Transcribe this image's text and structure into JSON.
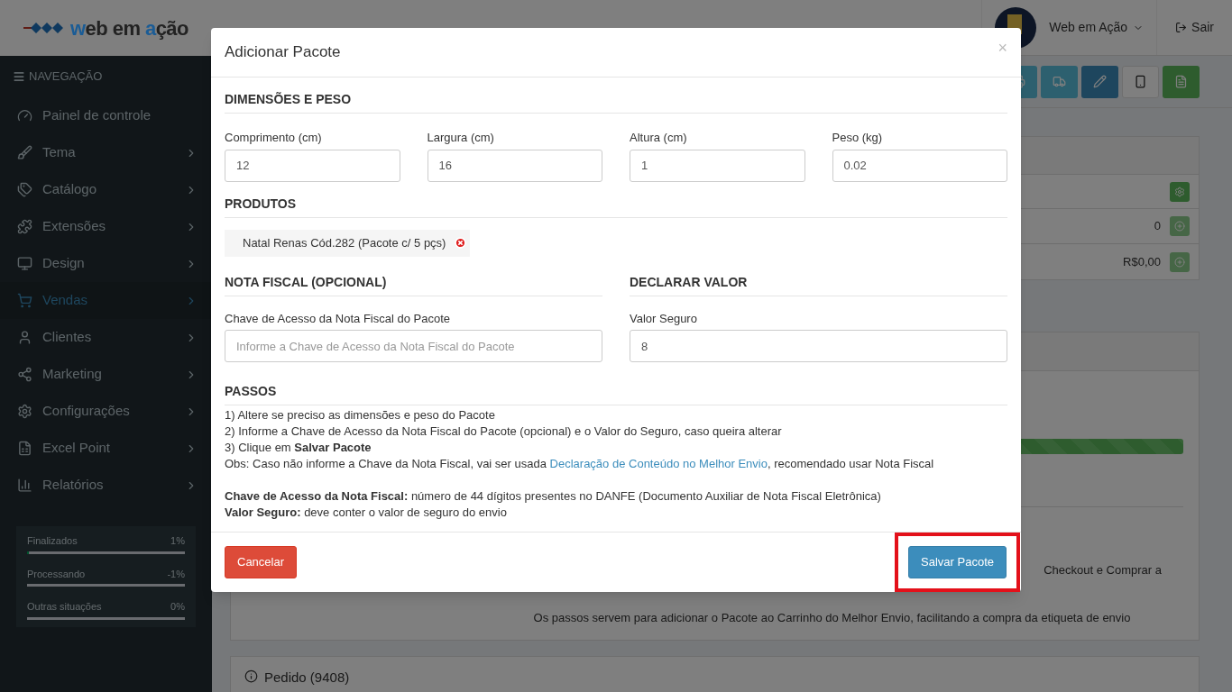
{
  "header": {
    "logo": [
      {
        "text": "w",
        "color": "#1a5c96"
      },
      {
        "text": "eb em ",
        "color": "#222222"
      },
      {
        "text": "a",
        "color": "#1a5c96"
      },
      {
        "text": "ção",
        "color": "#222222"
      }
    ],
    "user": "Web em Ação",
    "logout": "Sair"
  },
  "sidebar": {
    "heading": "NAVEGAÇÃO",
    "items": [
      {
        "label": "Painel de controle",
        "selected": false,
        "expandable": false
      },
      {
        "label": "Tema",
        "selected": false,
        "expandable": true
      },
      {
        "label": "Catálogo",
        "selected": false,
        "expandable": true
      },
      {
        "label": "Extensões",
        "selected": false,
        "expandable": true
      },
      {
        "label": "Design",
        "selected": false,
        "expandable": true
      },
      {
        "label": "Vendas",
        "selected": true,
        "expandable": true
      },
      {
        "label": "Clientes",
        "selected": false,
        "expandable": true
      },
      {
        "label": "Marketing",
        "selected": false,
        "expandable": true
      },
      {
        "label": "Configurações",
        "selected": false,
        "expandable": true
      },
      {
        "label": "Excel Point",
        "selected": false,
        "expandable": true
      },
      {
        "label": "Relatórios",
        "selected": false,
        "expandable": true
      }
    ],
    "stats": [
      {
        "label": "Finalizados",
        "value": "1%",
        "level": 0.01
      },
      {
        "label": "Processando",
        "value": "-1%"
      },
      {
        "label": "Outras situações",
        "value": "0%"
      }
    ]
  },
  "order_panel": {
    "rows": [
      "0",
      "R$0,00"
    ]
  },
  "shipping_panel": {
    "progress": {
      "level": 1
    },
    "text_cut": "Checkout e Comprar a",
    "note": "Os passos servem para adicionar o Pacote ao Carrinho do Melhor Envio, facilitando a compra da etiqueta de envio"
  },
  "pedido_panel": {
    "title": "Pedido (9408)"
  },
  "modal": {
    "title": "Adicionar Pacote",
    "close": "×",
    "dimensions": {
      "title": "DIMENSÕES E PESO",
      "fields": [
        {
          "label": "Comprimento (cm)",
          "value": "12"
        },
        {
          "label": "Largura (cm)",
          "value": "16"
        },
        {
          "label": "Altura (cm)",
          "value": "1"
        },
        {
          "label": "Peso (kg)",
          "value": "0.02"
        }
      ]
    },
    "products": {
      "title": "PRODUTOS",
      "items": [
        "Natal Renas Cód.282 (Pacote c/ 5 pçs)"
      ]
    },
    "invoice": {
      "title": "NOTA FISCAL (OPCIONAL)",
      "label": "Chave de Acesso da Nota Fiscal do Pacote",
      "placeholder": "Informe a Chave de Acesso da Nota Fiscal do Pacote"
    },
    "declare": {
      "title": "DECLARAR VALOR",
      "label": "Valor Seguro",
      "value": "8"
    },
    "steps": {
      "title": "PASSOS",
      "lines": [
        "1) Altere se preciso as dimensões e peso do Pacote",
        "2) Informe a Chave de Acesso da Nota Fiscal do Pacote (opcional) e o Valor do Seguro, caso queira alterar",
        "3) Clique em **Salvar Pacote**"
      ],
      "obs": {
        "before": "Obs: Caso não informe a Chave da Nota Fiscal, vai ser usada ",
        "link": "Declaração de Conteúdo no Melhor Envio",
        "after": ", recomendado usar Nota Fiscal"
      },
      "definitions": [
        "**Chave de Acesso da Nota Fiscal:** número de 44 dígitos presentes no DANFE (Documento Auxiliar de Nota Fiscal Eletrônica)",
        "**Valor Seguro:** deve conter o valor de seguro do envio"
      ]
    },
    "cancel": "Cancelar",
    "save": {
      "label": "Salvar Pacote",
      "highlighted": true
    }
  }
}
